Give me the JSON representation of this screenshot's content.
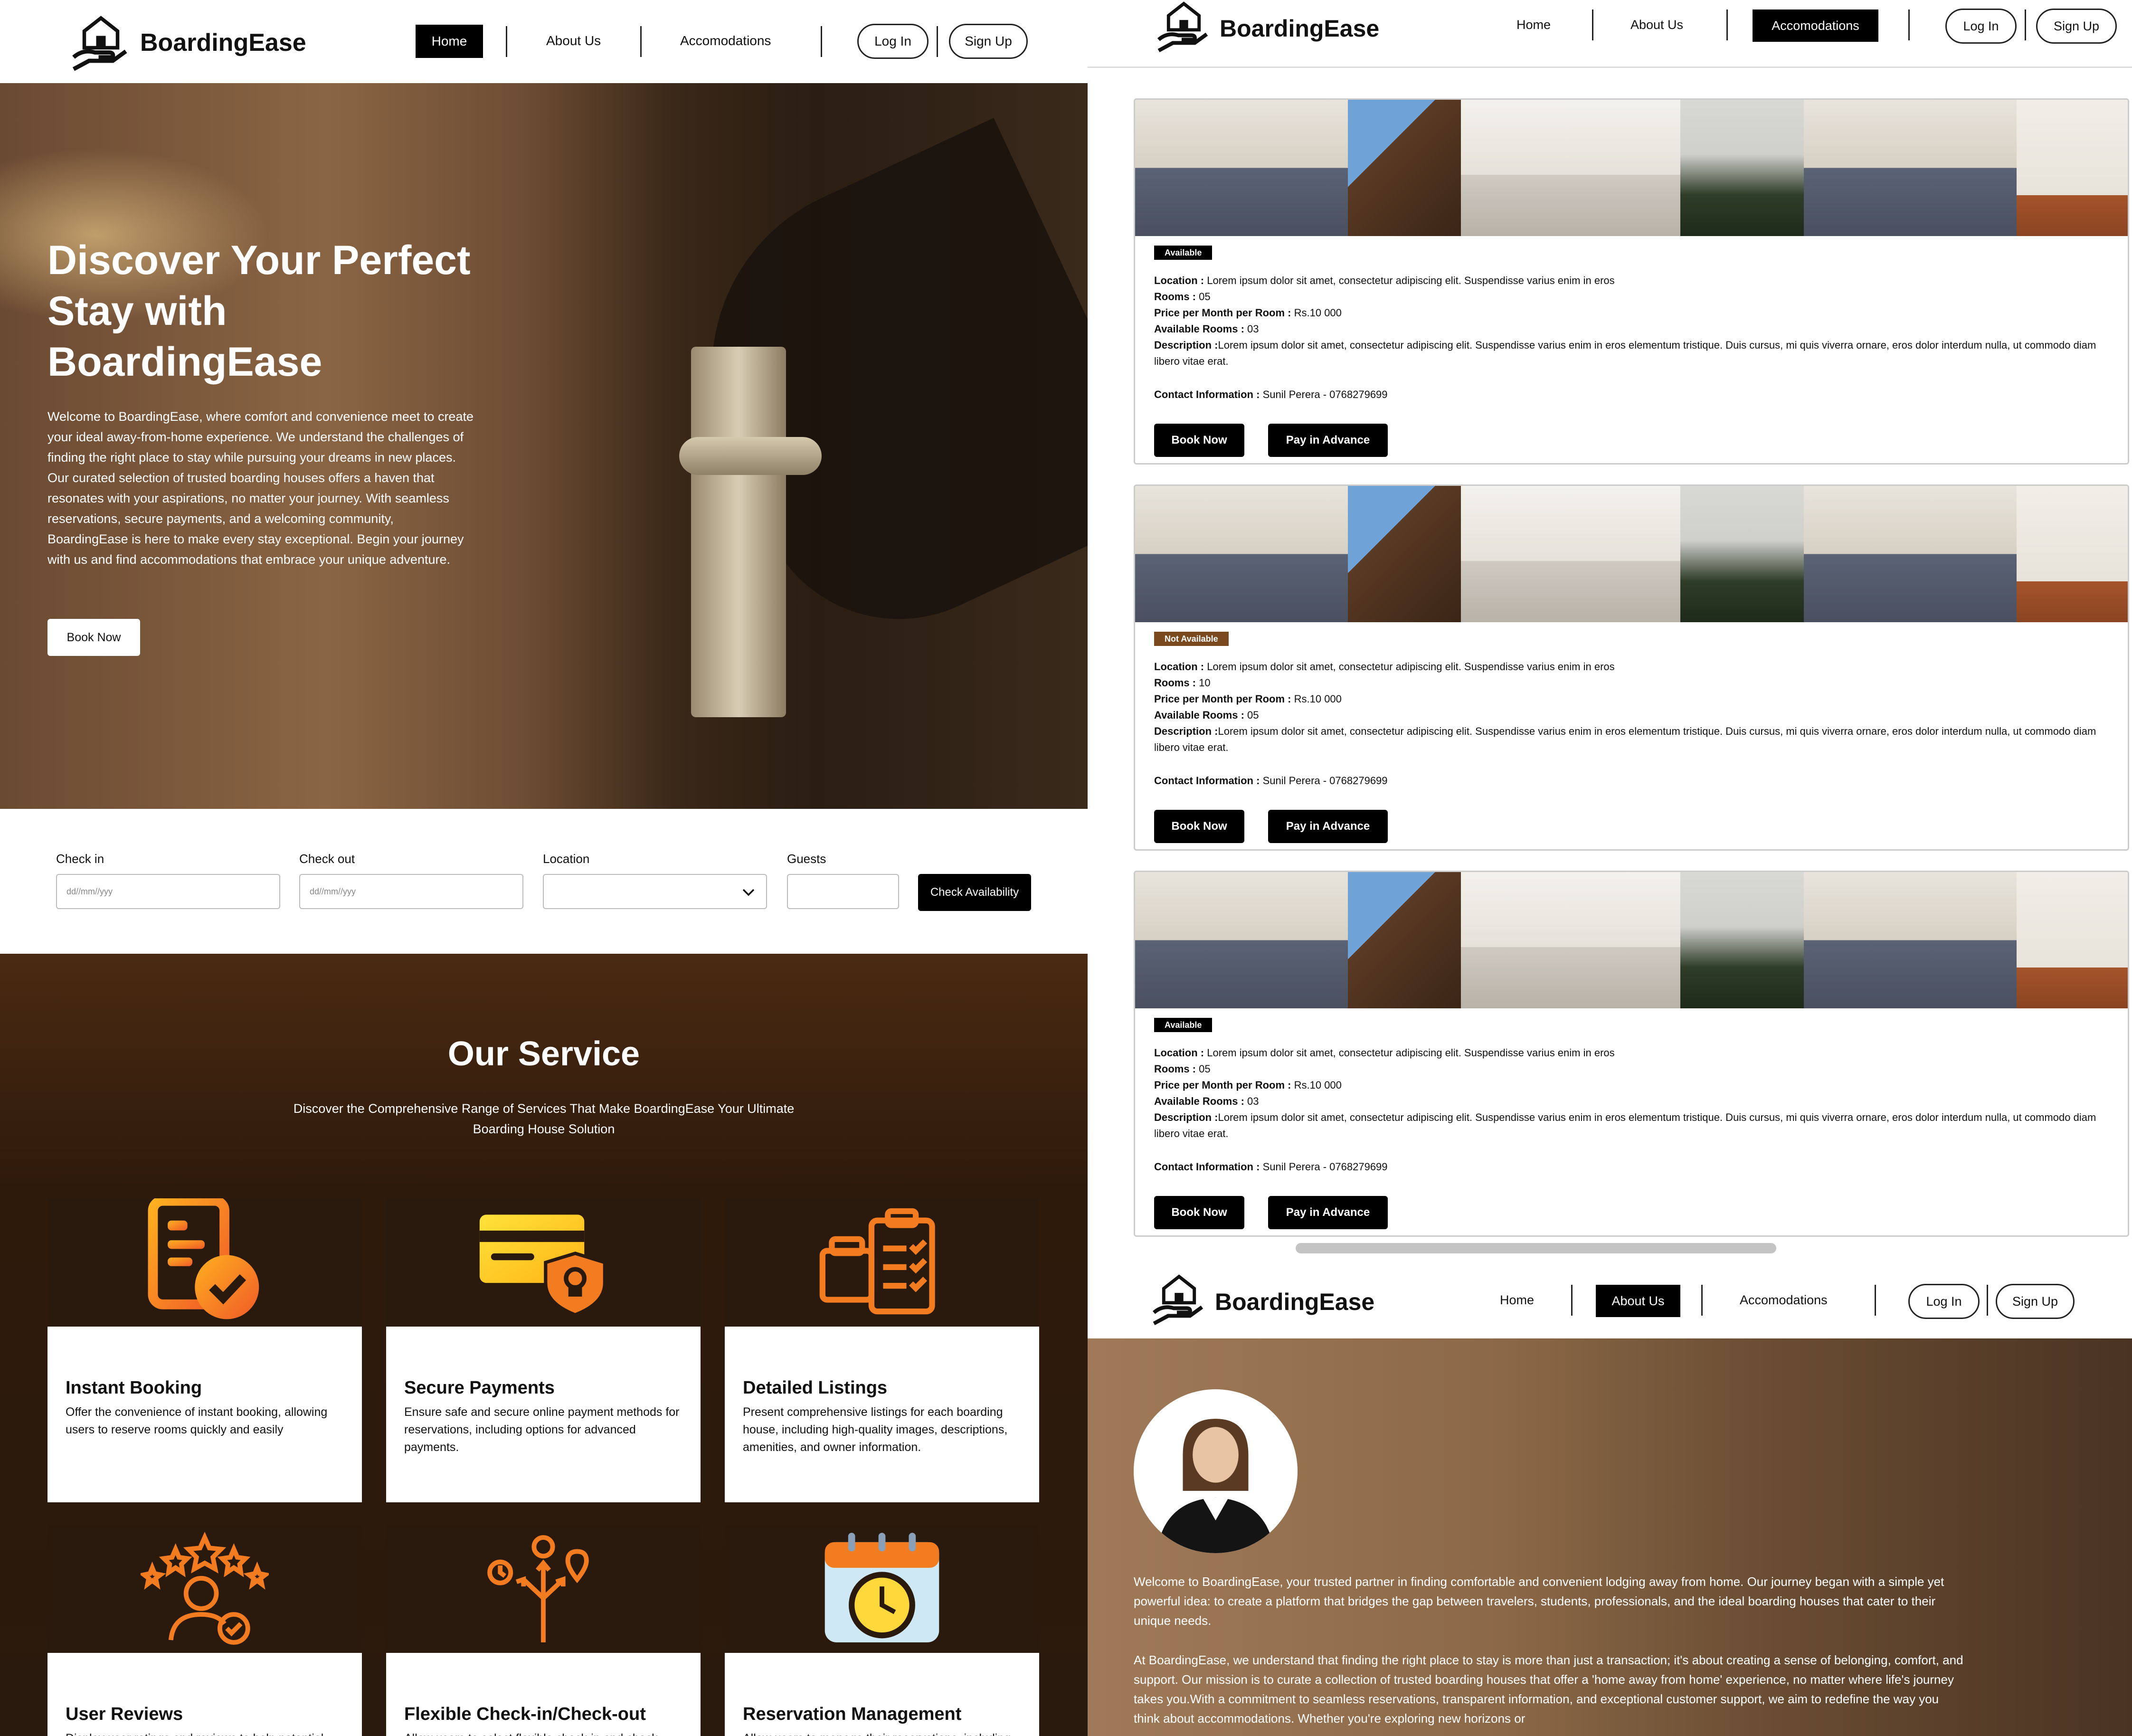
{
  "brand": {
    "name": "BoardingEase"
  },
  "home": {
    "nav": {
      "home": "Home",
      "about": "About Us",
      "accommodations": "Accomodations",
      "login": "Log In",
      "signup": "Sign Up"
    },
    "hero": {
      "title_line1": "Discover Your Perfect",
      "title_line2": "Stay with",
      "title_line3": "BoardingEase",
      "body": "Welcome to BoardingEase, where comfort and convenience meet to create your ideal away-from-home experience. We understand the challenges of finding the right place to stay while pursuing your dreams in new places. Our curated selection of trusted boarding houses offers a haven that resonates with your aspirations, no matter your journey. With seamless reservations, secure payments, and a welcoming community, BoardingEase is here to make every stay exceptional. Begin your journey with us and find accommodations that embrace your unique adventure.",
      "cta": "Book Now"
    },
    "search": {
      "checkin_label": "Check in",
      "checkin_placeholder": "dd//mm//yyy",
      "checkout_label": "Check out",
      "checkout_placeholder": "dd//mm//yyy",
      "location_label": "Location",
      "guests_label": "Guests",
      "submit": "Check Availability"
    },
    "services": {
      "title": "Our Service",
      "subtitle_line1": "Discover the Comprehensive Range of Services That Make BoardingEase Your Ultimate",
      "subtitle_line2": "Boarding House Solution",
      "items": [
        {
          "title": "Instant Booking",
          "desc": "Offer the convenience of instant booking, allowing users to reserve rooms quickly and easily",
          "icon": "document-check-icon"
        },
        {
          "title": "Secure Payments",
          "desc": "Ensure safe and secure online payment methods for reservations, including options for advanced payments.",
          "icon": "card-shield-icon"
        },
        {
          "title": "Detailed Listings",
          "desc": "Present comprehensive listings for each boarding house, including high-quality images, descriptions, amenities, and owner information.",
          "icon": "clipboard-list-icon"
        },
        {
          "title": "User Reviews",
          "desc": "Display user ratings and reviews to help potential",
          "icon": "user-stars-icon"
        },
        {
          "title": "Flexible Check-in/Check-out",
          "desc": "Allow users to select flexible check-in and check",
          "icon": "route-options-icon"
        },
        {
          "title": "Reservation Management",
          "desc": "Allow users to manage their reservations, including",
          "icon": "calendar-clock-icon"
        }
      ]
    }
  },
  "accommodations": {
    "nav": {
      "home": "Home",
      "about": "About Us",
      "accommodations": "Accomodations",
      "login": "Log In",
      "signup": "Sign Up"
    },
    "labels": {
      "location": "Location :",
      "rooms": "Rooms :",
      "price": "Price per Month per Room :",
      "available": "Available Rooms :",
      "description": "Description :",
      "contact": "Contact Information :",
      "book": "Book Now",
      "pay": "Pay in Advance"
    },
    "listings": [
      {
        "status": "Available",
        "status_color": "#000000",
        "location": "Lorem ipsum dolor sit amet, consectetur adipiscing elit. Suspendisse varius enim in eros",
        "rooms": "05",
        "price": "Rs.10 000",
        "available_rooms": "03",
        "description": "Lorem ipsum dolor sit amet, consectetur adipiscing elit. Suspendisse varius enim in eros elementum tristique. Duis cursus, mi quis viverra ornare, eros dolor interdum nulla, ut commodo diam libero vitae erat.",
        "contact": "Sunil Perera - 0768279699"
      },
      {
        "status": "Not Available",
        "status_color": "#7a4a1e",
        "location": "Lorem ipsum dolor sit amet, consectetur adipiscing elit. Suspendisse varius enim in eros",
        "rooms": "10",
        "price": "Rs.10 000",
        "available_rooms": "05",
        "description": "Lorem ipsum dolor sit amet, consectetur adipiscing elit. Suspendisse varius enim in eros elementum tristique. Duis cursus, mi quis viverra ornare, eros dolor interdum nulla, ut commodo diam libero vitae erat.",
        "contact": "Sunil Perera - 0768279699"
      },
      {
        "status": "Available",
        "status_color": "#000000",
        "location": "Lorem ipsum dolor sit amet, consectetur adipiscing elit. Suspendisse varius enim in eros",
        "rooms": "05",
        "price": "Rs.10 000",
        "available_rooms": "03",
        "description": "Lorem ipsum dolor sit amet, consectetur adipiscing elit. Suspendisse varius enim in eros elementum tristique. Duis cursus, mi quis viverra ornare, eros dolor interdum nulla, ut commodo diam libero vitae erat.",
        "contact": "Sunil Perera - 0768279699"
      }
    ]
  },
  "about": {
    "nav": {
      "home": "Home",
      "about": "About Us",
      "accommodations": "Accomodations",
      "login": "Log In",
      "signup": "Sign Up"
    },
    "para1": "Welcome to BoardingEase, your trusted partner in finding comfortable and convenient lodging away from home. Our journey began with a simple yet powerful idea: to create a platform that bridges the gap between travelers, students, professionals, and the ideal boarding houses that cater to their unique needs.",
    "para2": "At BoardingEase, we understand that finding the right place to stay is more than just a transaction; it's about creating a sense of belonging, comfort, and support. Our mission is to curate a collection of trusted boarding houses that offer a 'home away from home' experience, no matter where life's journey takes you.With a commitment to seamless reservations, transparent information, and exceptional customer support, we aim to redefine the way you think about accommodations. Whether you're exploring new horizons or"
  },
  "colors": {
    "accent_brown": "#2a1a0d",
    "icon_orange": "#f47c20",
    "icon_yellow": "#ffc21a",
    "not_available": "#7a4a1e"
  }
}
